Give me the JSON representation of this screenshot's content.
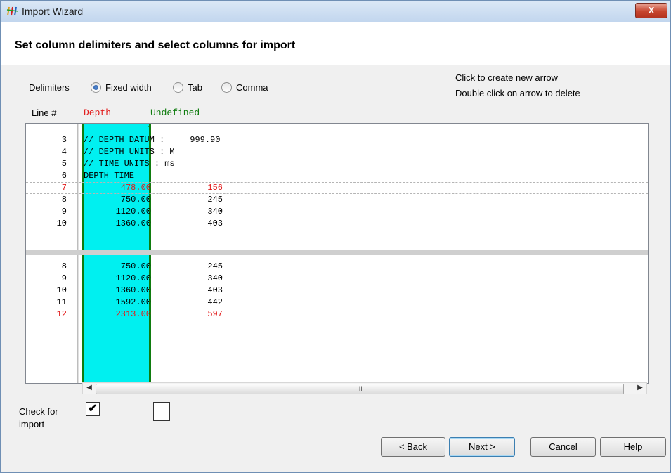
{
  "window": {
    "title": "Import Wizard",
    "close_label": "X"
  },
  "header": {
    "title": "Set column delimiters and select columns for import"
  },
  "delimiters": {
    "label": "Delimiters",
    "options": [
      {
        "label": "Fixed width",
        "selected": true
      },
      {
        "label": "Tab",
        "selected": false
      },
      {
        "label": "Comma",
        "selected": false
      }
    ]
  },
  "hints": [
    "Click to create new arrow",
    "Double click on arrow to delete"
  ],
  "grid": {
    "line_header": "Line #",
    "columns": [
      {
        "name": "Depth",
        "color": "#e21a1a"
      },
      {
        "name": "Undefined",
        "color": "#0f7c0f"
      }
    ],
    "top_rows": [
      {
        "num": "3",
        "text": "// DEPTH DATUM :     999.90",
        "red": false
      },
      {
        "num": "4",
        "text": "// DEPTH UNITS : M",
        "red": false
      },
      {
        "num": "5",
        "text": "// TIME UNITS : ms",
        "red": false
      },
      {
        "num": "6",
        "text": "DEPTH TIME",
        "red": false
      },
      {
        "num": "7",
        "c1": "478.00",
        "c2": "156",
        "red": true
      },
      {
        "num": "8",
        "c1": "750.00",
        "c2": "245",
        "red": false
      },
      {
        "num": "9",
        "c1": "1120.00",
        "c2": "340",
        "red": false
      },
      {
        "num": "10",
        "c1": "1360.00",
        "c2": "403",
        "red": false
      }
    ],
    "bottom_rows": [
      {
        "num": "8",
        "c1": "750.00",
        "c2": "245",
        "red": false
      },
      {
        "num": "9",
        "c1": "1120.00",
        "c2": "340",
        "red": false
      },
      {
        "num": "10",
        "c1": "1360.00",
        "c2": "403",
        "red": false
      },
      {
        "num": "11",
        "c1": "1592.00",
        "c2": "442",
        "red": false
      },
      {
        "num": "12",
        "c1": "2313.00",
        "c2": "597",
        "red": true
      }
    ],
    "scroll_thumb_label": "III"
  },
  "import_check": {
    "label_line1": "Check for",
    "label_line2": "import",
    "checks": [
      true,
      false
    ],
    "check_mark": "✔"
  },
  "buttons": {
    "back": "< Back",
    "next": "Next >",
    "cancel": "Cancel",
    "help": "Help"
  }
}
